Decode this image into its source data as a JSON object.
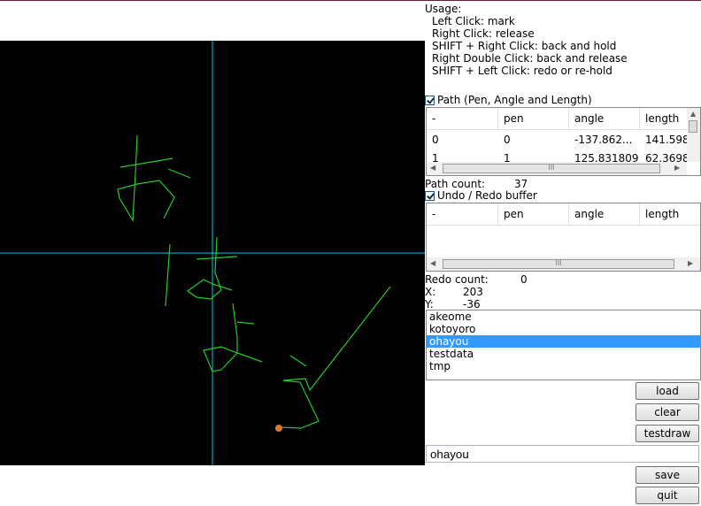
{
  "usage": {
    "title": "Usage:",
    "lines": [
      "Left Click: mark",
      "Right Click: release",
      "SHIFT + Right Click: back and hold",
      "Right Double Click: back and release",
      "SHIFT + Left Click: redo or re-hold"
    ]
  },
  "path_section": {
    "checkbox_label": "Path (Pen, Angle and Length)",
    "checked": true,
    "columns": [
      "-",
      "pen",
      "angle",
      "length"
    ],
    "rows": [
      [
        "0",
        "0",
        "-137.862...",
        "141.598"
      ],
      [
        "1",
        "1",
        "125.831809",
        "62.3698"
      ]
    ],
    "count_label": "Path count:",
    "count_value": "37"
  },
  "redo_section": {
    "checkbox_label": "Undo / Redo buffer",
    "checked": true,
    "columns": [
      "-",
      "pen",
      "angle",
      "length"
    ],
    "rows": [],
    "count_label": "Redo count:",
    "count_value": "0"
  },
  "cursor": {
    "x_label": "X:",
    "x_value": "203",
    "y_label": "Y:",
    "y_value": "-36"
  },
  "files": {
    "items": [
      "akeome",
      "kotoyoro",
      "ohayou",
      "testdata",
      "tmp"
    ],
    "selected": "ohayou"
  },
  "buttons": {
    "load": "load",
    "clear": "clear",
    "testdraw": "testdraw",
    "save": "save",
    "quit": "quit"
  },
  "filename_input": {
    "value": "ohayou"
  },
  "scroll_grip": "III",
  "colors": {
    "canvas_bg": "#000000",
    "crosshair": "#00c8e6",
    "stroke": "#22cc22",
    "pen_marker": "#e07830",
    "selection": "#3399ff"
  }
}
